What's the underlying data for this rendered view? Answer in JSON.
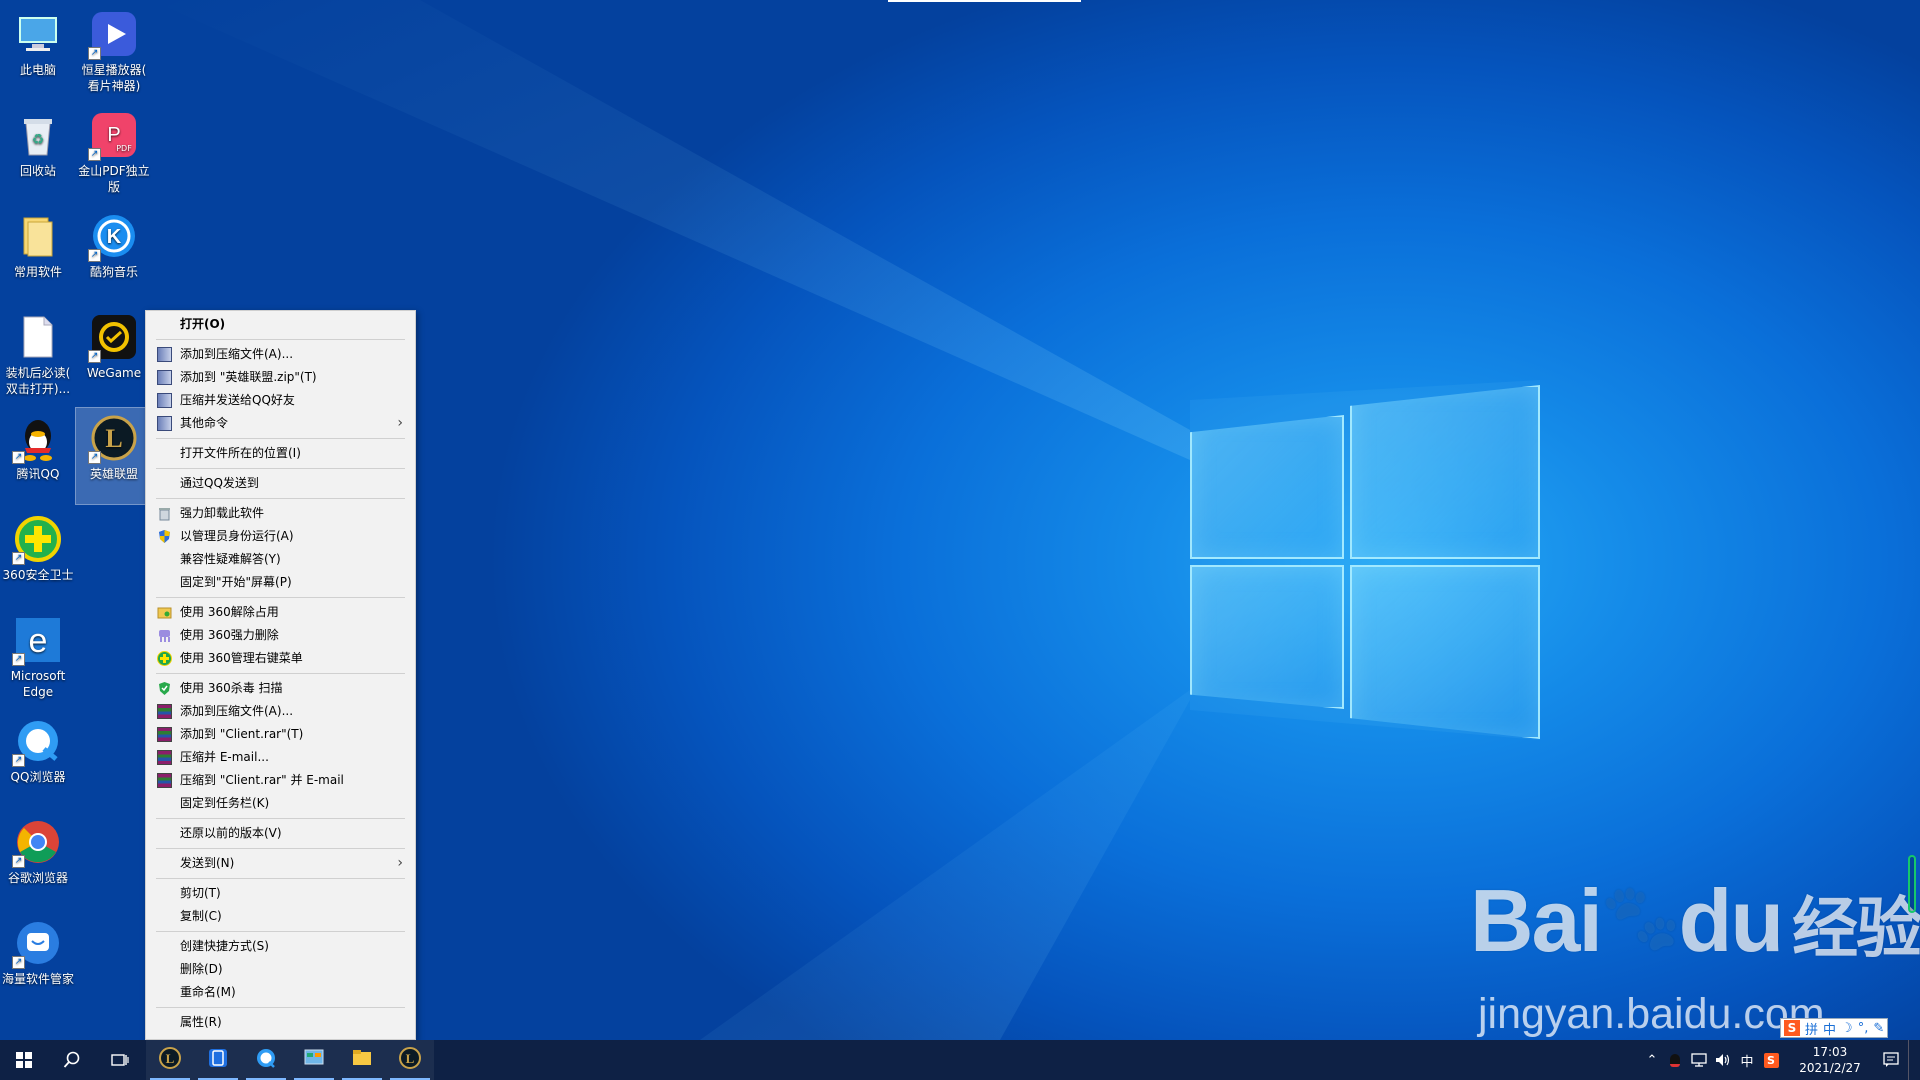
{
  "desktop": {
    "icons": [
      {
        "name": "此电脑",
        "icon": "computer-icon"
      },
      {
        "name": "恒星播放器(看片神器)",
        "line1": "恒星播放器(",
        "line2": "看片神器)",
        "icon": "video-player-icon"
      },
      {
        "name": "回收站",
        "icon": "recycle-bin-icon"
      },
      {
        "name": "金山PDF独立版",
        "line1": "金山PDF独立",
        "line2": "版",
        "icon": "pdf-icon",
        "badge": "PDF"
      },
      {
        "name": "常用软件",
        "icon": "folder-icon"
      },
      {
        "name": "酷狗音乐",
        "icon": "kugou-icon",
        "glyph": "K"
      },
      {
        "name": "装机后必读(双击打开)...",
        "line1": "装机后必读(",
        "line2": "双击打开)...",
        "icon": "document-icon"
      },
      {
        "name": "WeGame",
        "icon": "wegame-icon"
      },
      {
        "name": "腾讯QQ",
        "icon": "qq-penguin-icon"
      },
      {
        "name": "英雄联盟",
        "icon": "league-of-legends-icon",
        "glyph": "L"
      },
      {
        "name": "360安全卫士",
        "icon": "360-security-icon"
      },
      {
        "name": "Microsoft Edge",
        "line1": "Microsoft",
        "line2": "Edge",
        "icon": "edge-icon",
        "glyph": "e"
      },
      {
        "name": "QQ浏览器",
        "icon": "qq-browser-icon"
      },
      {
        "name": "谷歌浏览器",
        "icon": "chrome-icon"
      },
      {
        "name": "海量软件管家",
        "icon": "software-manager-icon"
      }
    ]
  },
  "context_menu": {
    "items": [
      {
        "label": "打开(O)",
        "bold": true,
        "icon": ""
      },
      {
        "sep": true
      },
      {
        "label": "添加到压缩文件(A)...",
        "icon": "winzip-icon"
      },
      {
        "label": "添加到 \"英雄联盟.zip\"(T)",
        "icon": "winzip-icon"
      },
      {
        "label": "压缩并发送给QQ好友",
        "icon": "winzip-icon"
      },
      {
        "label": "其他命令",
        "icon": "winzip-icon",
        "submenu": true
      },
      {
        "sep": true
      },
      {
        "label": "打开文件所在的位置(I)",
        "icon": ""
      },
      {
        "sep": true
      },
      {
        "label": "通过QQ发送到",
        "icon": ""
      },
      {
        "sep": true
      },
      {
        "label": "强力卸载此软件",
        "icon": "trash-icon"
      },
      {
        "label": "以管理员身份运行(A)",
        "icon": "uac-shield-icon"
      },
      {
        "label": "兼容性疑难解答(Y)",
        "icon": ""
      },
      {
        "label": "固定到\"开始\"屏幕(P)",
        "icon": ""
      },
      {
        "sep": true
      },
      {
        "label": "使用 360解除占用",
        "icon": "folder-unlock-icon"
      },
      {
        "label": "使用 360强力删除",
        "icon": "shred-icon"
      },
      {
        "label": "使用 360管理右键菜单",
        "icon": "360-plus-icon"
      },
      {
        "sep": true
      },
      {
        "label": "使用 360杀毒 扫描",
        "icon": "360-antivirus-icon"
      },
      {
        "label": "添加到压缩文件(A)...",
        "icon": "winrar-icon"
      },
      {
        "label": "添加到 \"Client.rar\"(T)",
        "icon": "winrar-icon"
      },
      {
        "label": "压缩并 E-mail...",
        "icon": "winrar-icon"
      },
      {
        "label": "压缩到 \"Client.rar\" 并 E-mail",
        "icon": "winrar-icon"
      },
      {
        "label": "固定到任务栏(K)",
        "icon": ""
      },
      {
        "sep": true
      },
      {
        "label": "还原以前的版本(V)",
        "icon": ""
      },
      {
        "sep": true
      },
      {
        "label": "发送到(N)",
        "icon": "",
        "submenu": true
      },
      {
        "sep": true
      },
      {
        "label": "剪切(T)",
        "icon": ""
      },
      {
        "label": "复制(C)",
        "icon": ""
      },
      {
        "sep": true
      },
      {
        "label": "创建快捷方式(S)",
        "icon": ""
      },
      {
        "label": "删除(D)",
        "icon": ""
      },
      {
        "label": "重命名(M)",
        "icon": ""
      },
      {
        "sep": true
      },
      {
        "label": "属性(R)",
        "icon": ""
      }
    ]
  },
  "taskbar": {
    "apps": [
      {
        "icon": "league-of-legends-icon",
        "active": true
      },
      {
        "icon": "tablet-app-icon",
        "active": true
      },
      {
        "icon": "qq-browser-icon",
        "active": true
      },
      {
        "icon": "control-panel-icon",
        "active": true
      },
      {
        "icon": "file-explorer-icon",
        "active": true
      },
      {
        "icon": "league-of-legends-icon",
        "active": true
      }
    ],
    "tray": {
      "lang": "中",
      "sogou": "S",
      "time": "17:03",
      "date": "2021/2/27"
    }
  },
  "ime_toolbar": {
    "items": [
      "拼",
      "中",
      "☽",
      "°,",
      "✎"
    ]
  },
  "watermark": {
    "brand": "Bai",
    "brand2": "du",
    "cn": "经验",
    "url": "jingyan.baidu.com"
  },
  "colors": {
    "desktop_bg": "#0a6fd9",
    "taskbar": "#0e2145",
    "menu_bg": "#f2f2f2"
  }
}
